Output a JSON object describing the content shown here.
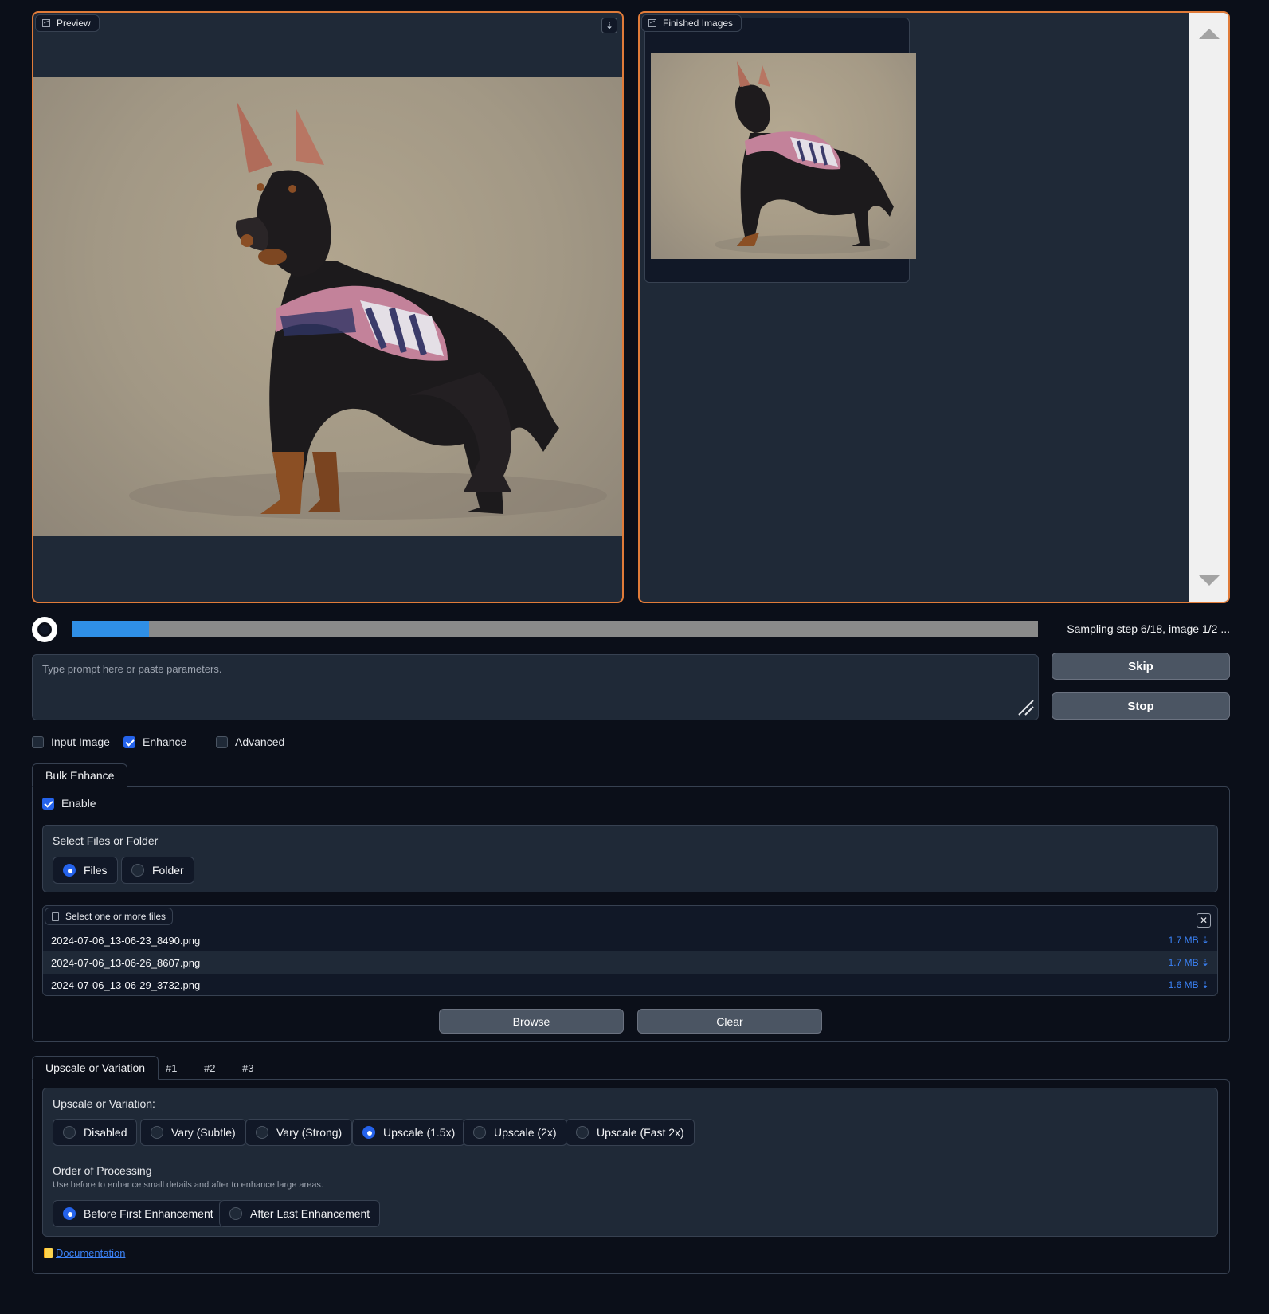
{
  "preview": {
    "label": "Preview",
    "icon": "image-icon",
    "download_icon": "download-icon"
  },
  "finished": {
    "label": "Finished Images",
    "icon": "image-icon"
  },
  "progress": {
    "fraction": 0.08,
    "text": "Sampling step 6/18, image 1/2 ..."
  },
  "prompt": {
    "placeholder": "Type prompt here or paste parameters."
  },
  "actions": {
    "skip": "Skip",
    "stop": "Stop"
  },
  "options": {
    "input_image": "Input Image",
    "enhance": "Enhance",
    "advanced": "Advanced"
  },
  "bulk": {
    "tab": "Bulk Enhance",
    "enable": "Enable",
    "select_label": "Select Files or Folder",
    "radio_files": "Files",
    "radio_folder": "Folder",
    "files_label": "Select one or more files",
    "files": [
      {
        "name": "2024-07-06_13-06-23_8490.png",
        "size": "1.7 MB ⇣"
      },
      {
        "name": "2024-07-06_13-06-26_8607.png",
        "size": "1.7 MB ⇣"
      },
      {
        "name": "2024-07-06_13-06-29_3732.png",
        "size": "1.6 MB ⇣"
      }
    ],
    "browse": "Browse",
    "clear": "Clear"
  },
  "enhance_tabs": {
    "tabs": [
      "Upscale or Variation",
      "#1",
      "#2",
      "#3"
    ],
    "upscale_label": "Upscale or Variation:",
    "upscale_options": [
      "Disabled",
      "Vary (Subtle)",
      "Vary (Strong)",
      "Upscale (1.5x)",
      "Upscale (2x)",
      "Upscale (Fast 2x)"
    ],
    "upscale_selected": "Upscale (1.5x)",
    "order_label": "Order of Processing",
    "order_info": "Use before to enhance small details and after to enhance large areas.",
    "order_options": [
      "Before First Enhancement",
      "After Last Enhancement"
    ],
    "order_selected": "Before First Enhancement"
  },
  "documentation": "Documentation",
  "colors": {
    "accent_border": "#e07b39",
    "progress": "#2f8fe6",
    "checked": "#2563eb"
  }
}
